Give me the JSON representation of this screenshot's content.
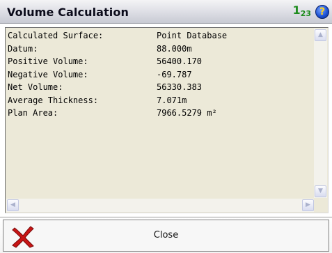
{
  "window": {
    "title": "Volume Calculation",
    "keypad_glyph": "1",
    "keypad_glyph_sub": "23",
    "help_glyph": "?"
  },
  "report": {
    "rows": [
      {
        "label": "Calculated Surface:",
        "value": "Point Database"
      },
      {
        "label": "Datum:",
        "value": "88.000m"
      },
      {
        "label": "Positive Volume:",
        "value": "56400.170"
      },
      {
        "label": "Negative Volume:",
        "value": "-69.787"
      },
      {
        "label": "Net Volume:",
        "value": "56330.383"
      },
      {
        "label": "Average Thickness:",
        "value": "7.071m"
      },
      {
        "label": "Plan Area:",
        "value": "7966.5279 m²"
      }
    ]
  },
  "footer": {
    "close_label": "Close"
  }
}
